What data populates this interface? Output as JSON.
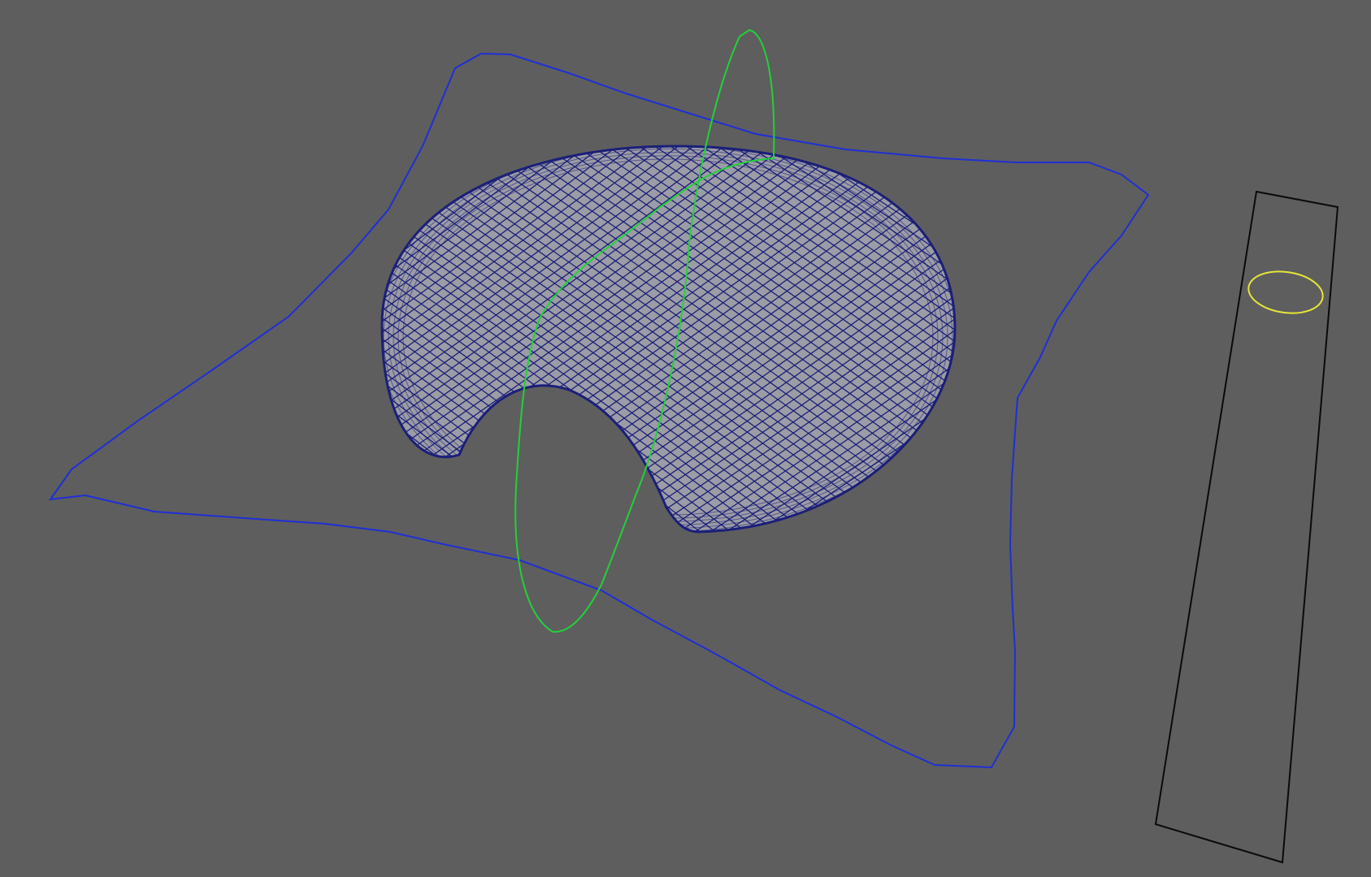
{
  "viewport": {
    "background": "#5e5e5e"
  },
  "scene": {
    "surface": {
      "fill": "#9c9ca6",
      "wire": "#1b1f78"
    },
    "blue_curve": {
      "color": "#1f2fd6"
    },
    "green_curve": {
      "color": "#22d13a"
    },
    "yellow_curve": {
      "color": "#e6e63a"
    },
    "black_plane": {
      "color": "#0a0a0a"
    }
  }
}
